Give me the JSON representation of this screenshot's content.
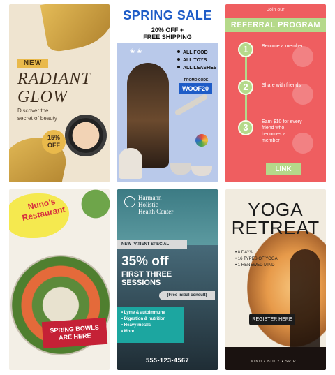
{
  "card1": {
    "new_label": "NEW",
    "title_line1": "RADIANT",
    "title_line2": "GLOW",
    "subtitle_line1": "Discover the",
    "subtitle_line2": "secret of beauty",
    "badge_line1": "15%",
    "badge_line2": "OFF"
  },
  "card2": {
    "title": "SPRING SALE",
    "subtitle_line1": "20% OFF +",
    "subtitle_line2": "FREE SHIPPING",
    "items": [
      "ALL FOOD",
      "ALL TOYS",
      "ALL LEASHES"
    ],
    "promo_label": "PROMO CODE",
    "promo_code": "WOOF20"
  },
  "card3": {
    "join_text": "Join our",
    "heading": "REFERRAL PROGRAM",
    "steps": [
      {
        "num": "1",
        "text": "Become a member"
      },
      {
        "num": "2",
        "text": "Share with friends"
      },
      {
        "num": "3",
        "text": "Earn $10 for every friend who becomes a member"
      }
    ],
    "link_label": "LINK"
  },
  "card4": {
    "title_line1": "Nuno's",
    "title_line2": "Restaurant",
    "banner_line1": "SPRING BOWLS",
    "banner_line2": "ARE HERE"
  },
  "card5": {
    "brand_line1": "Harmann",
    "brand_line2": "Holistic",
    "brand_line3": "Health Center",
    "tag": "NEW PATIENT SPECIAL",
    "big": "35% off",
    "mid_line1": "FIRST THREE",
    "mid_line2": "SESSIONS",
    "consult": "(Free initial consult)",
    "bullets": [
      "Lyme & autoimmune",
      "Digestion & nutrition",
      "Heavy metals",
      "More"
    ],
    "phone": "555-123-4567"
  },
  "card6": {
    "title_line1": "YOGA",
    "title_line2": "RETREAT",
    "list": [
      "8 DAYS",
      "16 TYPES OF YOGA",
      "1 RENEWED MIND"
    ],
    "register_label": "REGISTER HERE",
    "footer": "MIND • BODY • SPIRIT"
  }
}
